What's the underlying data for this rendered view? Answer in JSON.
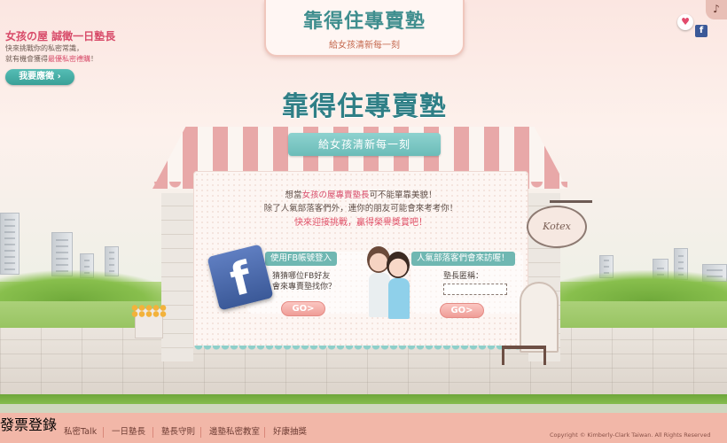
{
  "banner": {
    "logo": "靠得住專賣塾",
    "tagline": "給女孩清新每一刻"
  },
  "promo": {
    "title": "女孩の屋 誠徵一日塾長",
    "line1": "快來挑戰你的私密常識，",
    "line2_pre": "就有機會獲得",
    "line2_hl": "最優私密禮購",
    "line2_post": "！",
    "apply_button": "我要應徵"
  },
  "icons": {
    "heart": "heart-icon",
    "facebook": "facebook-icon",
    "music": "music-note-icon"
  },
  "shop": {
    "logo": "靠得住專賣塾",
    "tagline": "給女孩清新每一刻",
    "intro_pre": "想當",
    "intro_hl": "女孩の屋專賣塾長",
    "intro_post": "可不能單靠美貌！",
    "intro_line2": "除了人氣部落客們外，連你的朋友可能會來考考你！",
    "intro_line3": "快來迎接挑戰，贏得榮譽獎賞吧！",
    "sign_text": "Kotex"
  },
  "fb_panel": {
    "header": "使用FB帳號登入",
    "line1": "猜猜哪位FB好友",
    "line2": "會來專賣塾找你？",
    "go": "GO>"
  },
  "blogger_panel": {
    "header": "人氣部落客們會來訪喔！",
    "label": "塾長匿稱：",
    "input_value": "",
    "go": "GO>"
  },
  "footer": {
    "home": "發票登錄",
    "nav": [
      "私密Talk",
      "一日塾長",
      "塾長守則",
      "邊塾私密教室",
      "好康抽獎"
    ],
    "copyright": "Copyright © Kimberly-Clark Taiwan. All Rights Reserved"
  },
  "colors": {
    "teal": "#55aaa1",
    "pink": "#e04f66",
    "footer_bg": "#f2b7a8",
    "facebook_blue": "#3b5998"
  }
}
